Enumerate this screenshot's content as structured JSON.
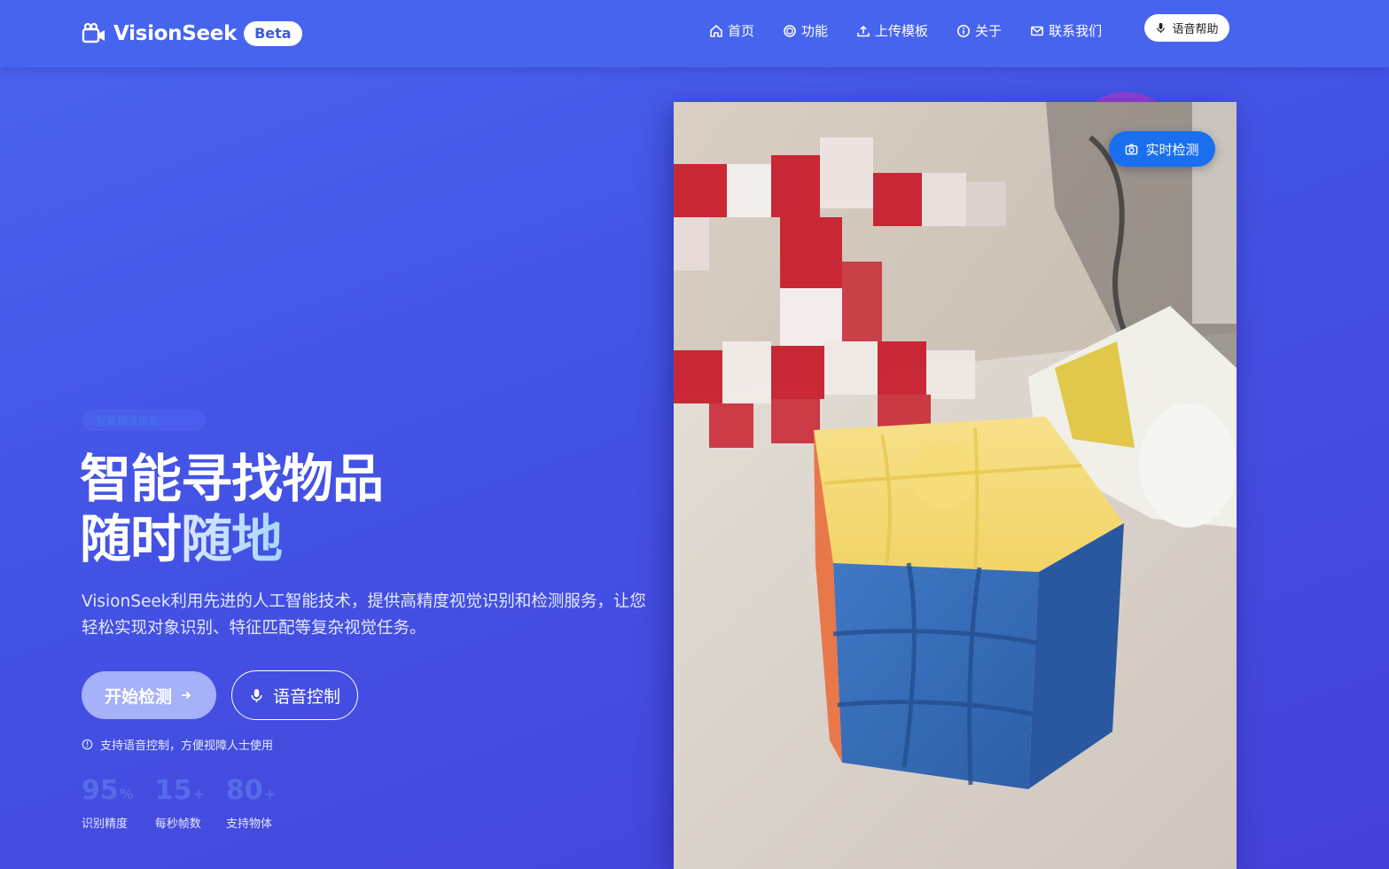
{
  "brand": {
    "name": "VisionSeek",
    "badge": "Beta"
  },
  "nav": {
    "items": [
      {
        "label": "首页",
        "icon": "home-icon"
      },
      {
        "label": "功能",
        "icon": "cube-icon"
      },
      {
        "label": "上传模板",
        "icon": "upload-icon"
      },
      {
        "label": "关于",
        "icon": "info-icon"
      },
      {
        "label": "联系我们",
        "icon": "mail-icon"
      }
    ],
    "voice_help": "语音帮助"
  },
  "hero": {
    "badge": "智能视觉识别",
    "title_line1": "智能寻找物品",
    "title_line2_a": "随时",
    "title_line2_b": "随地",
    "description": "VisionSeek利用先进的人工智能技术，提供高精度视觉识别和检测服务，让您轻松实现对象识别、特征匹配等复杂视觉任务。",
    "start_button": "开始检测",
    "voice_button": "语音控制",
    "hint": "支持语音控制，方便视障人士使用"
  },
  "stats": [
    {
      "value": "95",
      "suffix": "%",
      "label": "识别精度"
    },
    {
      "value": "15",
      "suffix": "+",
      "label": "每秒帧数"
    },
    {
      "value": "80",
      "suffix": "+",
      "label": "支持物体"
    }
  ],
  "photo": {
    "realtime_label": "实时检测"
  },
  "colors": {
    "accent": "#4664ee",
    "button_blue": "#1a6ff0",
    "start_button": "#a5b1f8"
  }
}
